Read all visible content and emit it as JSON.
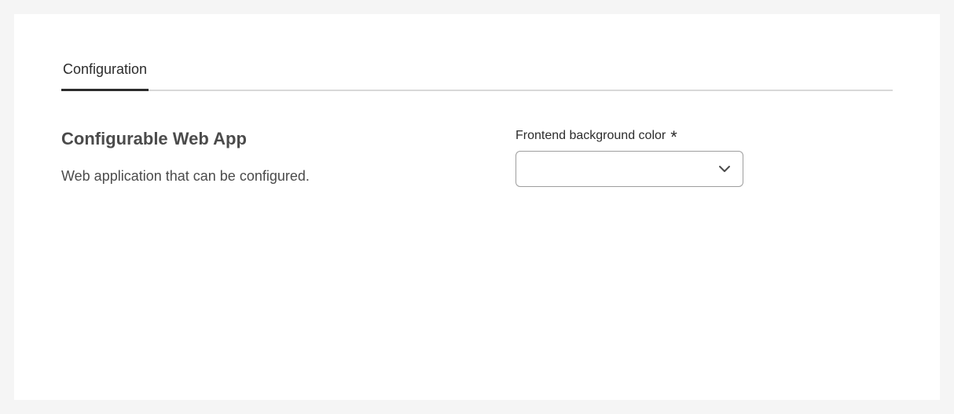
{
  "tabs": {
    "configuration": "Configuration"
  },
  "section": {
    "title": "Configurable Web App",
    "description": "Web application that can be configured."
  },
  "form": {
    "bgcolor_label": "Frontend background color",
    "required_mark": "*",
    "bgcolor_value": ""
  }
}
